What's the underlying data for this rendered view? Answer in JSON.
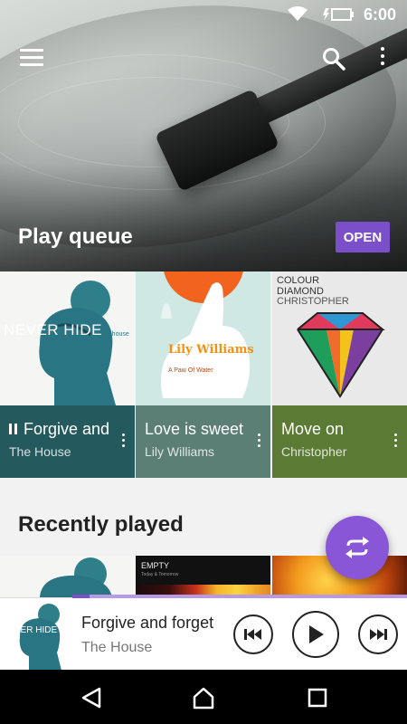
{
  "status": {
    "time": "6:00"
  },
  "header": {
    "queue_title": "Play queue",
    "open_label": "OPEN"
  },
  "queue": [
    {
      "title": "Forgive and forget",
      "artist": "The House",
      "art_text": "NEVER HIDE",
      "art_sub": "the house",
      "color": "#245a5e",
      "playing": true
    },
    {
      "title": "Love is sweet",
      "artist": "Lily Williams",
      "art_text": "Lily Williams",
      "art_sub": "A Paw Of Water",
      "color": "#5b7f74"
    },
    {
      "title": "Move on",
      "artist": "Christopher",
      "art_text": "COLOUR DIAMOND",
      "art_sub": "CHRISTOPHER",
      "color": "#5b7b34"
    }
  ],
  "recent": {
    "title": "Recently played",
    "items": [
      {
        "name": "never-hide"
      },
      {
        "label": "EMPTY",
        "sub": "Today & Tomorrow"
      },
      {
        "name": "fire"
      }
    ]
  },
  "player": {
    "title": "Forgive and forget",
    "artist": "The House",
    "thumb_text": "NEVER HIDE",
    "progress": 0.05
  },
  "colors": {
    "accent": "#7b4fc9",
    "fab": "#8a56d8"
  }
}
